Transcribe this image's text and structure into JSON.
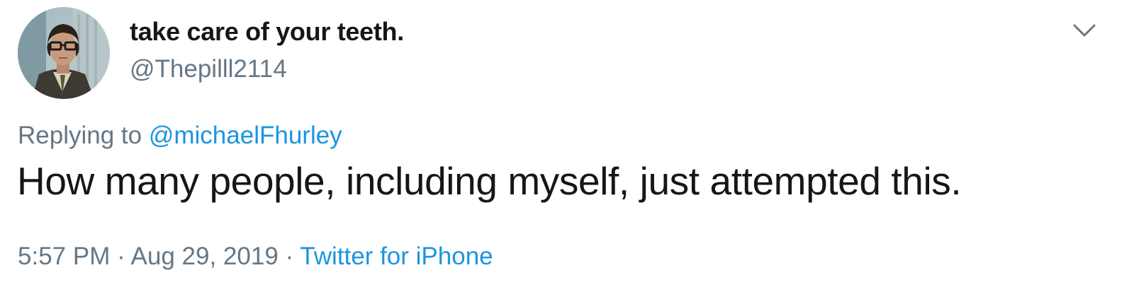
{
  "tweet": {
    "author": {
      "display_name": "take care of your teeth.",
      "handle": "@Thepilll2114",
      "avatar_icon": "profile-photo"
    },
    "menu_icon": "chevron-down-icon",
    "reply_context": {
      "prefix": "Replying to",
      "mention": "@michaelFhurley"
    },
    "text": "How many people, including myself, just attempted this.",
    "timestamp": {
      "time": "5:57 PM",
      "separator": "·",
      "date": "Aug 29, 2019",
      "source": "Twitter for iPhone"
    }
  },
  "colors": {
    "text": "#14171a",
    "secondary": "#657786",
    "link": "#1b95e0",
    "background": "#ffffff"
  }
}
